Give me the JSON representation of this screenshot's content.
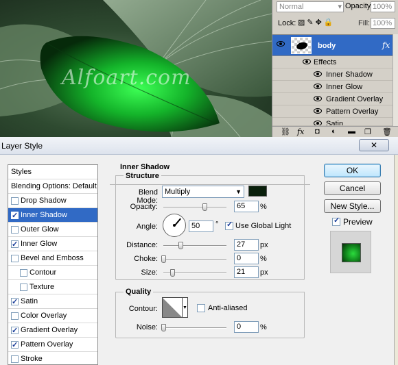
{
  "canvas": {
    "watermark": "Alfoart.com"
  },
  "layers_panel": {
    "blend_mode": "Normal",
    "opacity_label": "Opacity:",
    "opacity_value": "100%",
    "lock_label": "Lock:",
    "fill_label": "Fill:",
    "fill_value": "100%",
    "layer_name": "body",
    "fx_badge": "fx",
    "effects_label": "Effects",
    "effects": [
      "Inner Shadow",
      "Inner Glow",
      "Gradient Overlay",
      "Pattern Overlay",
      "Satin"
    ]
  },
  "dialog": {
    "title": "Layer Style",
    "close_glyph": "✕",
    "styles_list": [
      {
        "label": "Styles",
        "type": "header"
      },
      {
        "label": "Blending Options: Default",
        "type": "header"
      },
      {
        "label": "Drop Shadow",
        "checked": false
      },
      {
        "label": "Inner Shadow",
        "checked": true,
        "active": true
      },
      {
        "label": "Outer Glow",
        "checked": false
      },
      {
        "label": "Inner Glow",
        "checked": true
      },
      {
        "label": "Bevel and Emboss",
        "checked": false
      },
      {
        "label": "Contour",
        "checked": false,
        "sub": true
      },
      {
        "label": "Texture",
        "checked": false,
        "sub": true
      },
      {
        "label": "Satin",
        "checked": true
      },
      {
        "label": "Color Overlay",
        "checked": false
      },
      {
        "label": "Gradient Overlay",
        "checked": true
      },
      {
        "label": "Pattern Overlay",
        "checked": true
      },
      {
        "label": "Stroke",
        "checked": false
      }
    ],
    "section_title": "Inner Shadow",
    "structure": {
      "title": "Structure",
      "blend_mode_label": "Blend Mode:",
      "blend_mode": "Multiply",
      "shadow_color": "#0a200c",
      "opacity_label": "Opacity:",
      "opacity": "65",
      "opacity_unit": "%",
      "angle_label": "Angle:",
      "angle": "50",
      "angle_unit": "°",
      "use_global_light_label": "Use Global Light",
      "use_global_light": true,
      "distance_label": "Distance:",
      "distance": "27",
      "distance_unit": "px",
      "choke_label": "Choke:",
      "choke": "0",
      "choke_unit": "%",
      "size_label": "Size:",
      "size": "21",
      "size_unit": "px"
    },
    "quality": {
      "title": "Quality",
      "contour_label": "Contour:",
      "anti_aliased_label": "Anti-aliased",
      "anti_aliased": false,
      "noise_label": "Noise:",
      "noise": "0",
      "noise_unit": "%"
    },
    "buttons": {
      "ok": "OK",
      "cancel": "Cancel",
      "new_style": "New Style..."
    },
    "preview_label": "Preview",
    "preview_checked": true
  }
}
